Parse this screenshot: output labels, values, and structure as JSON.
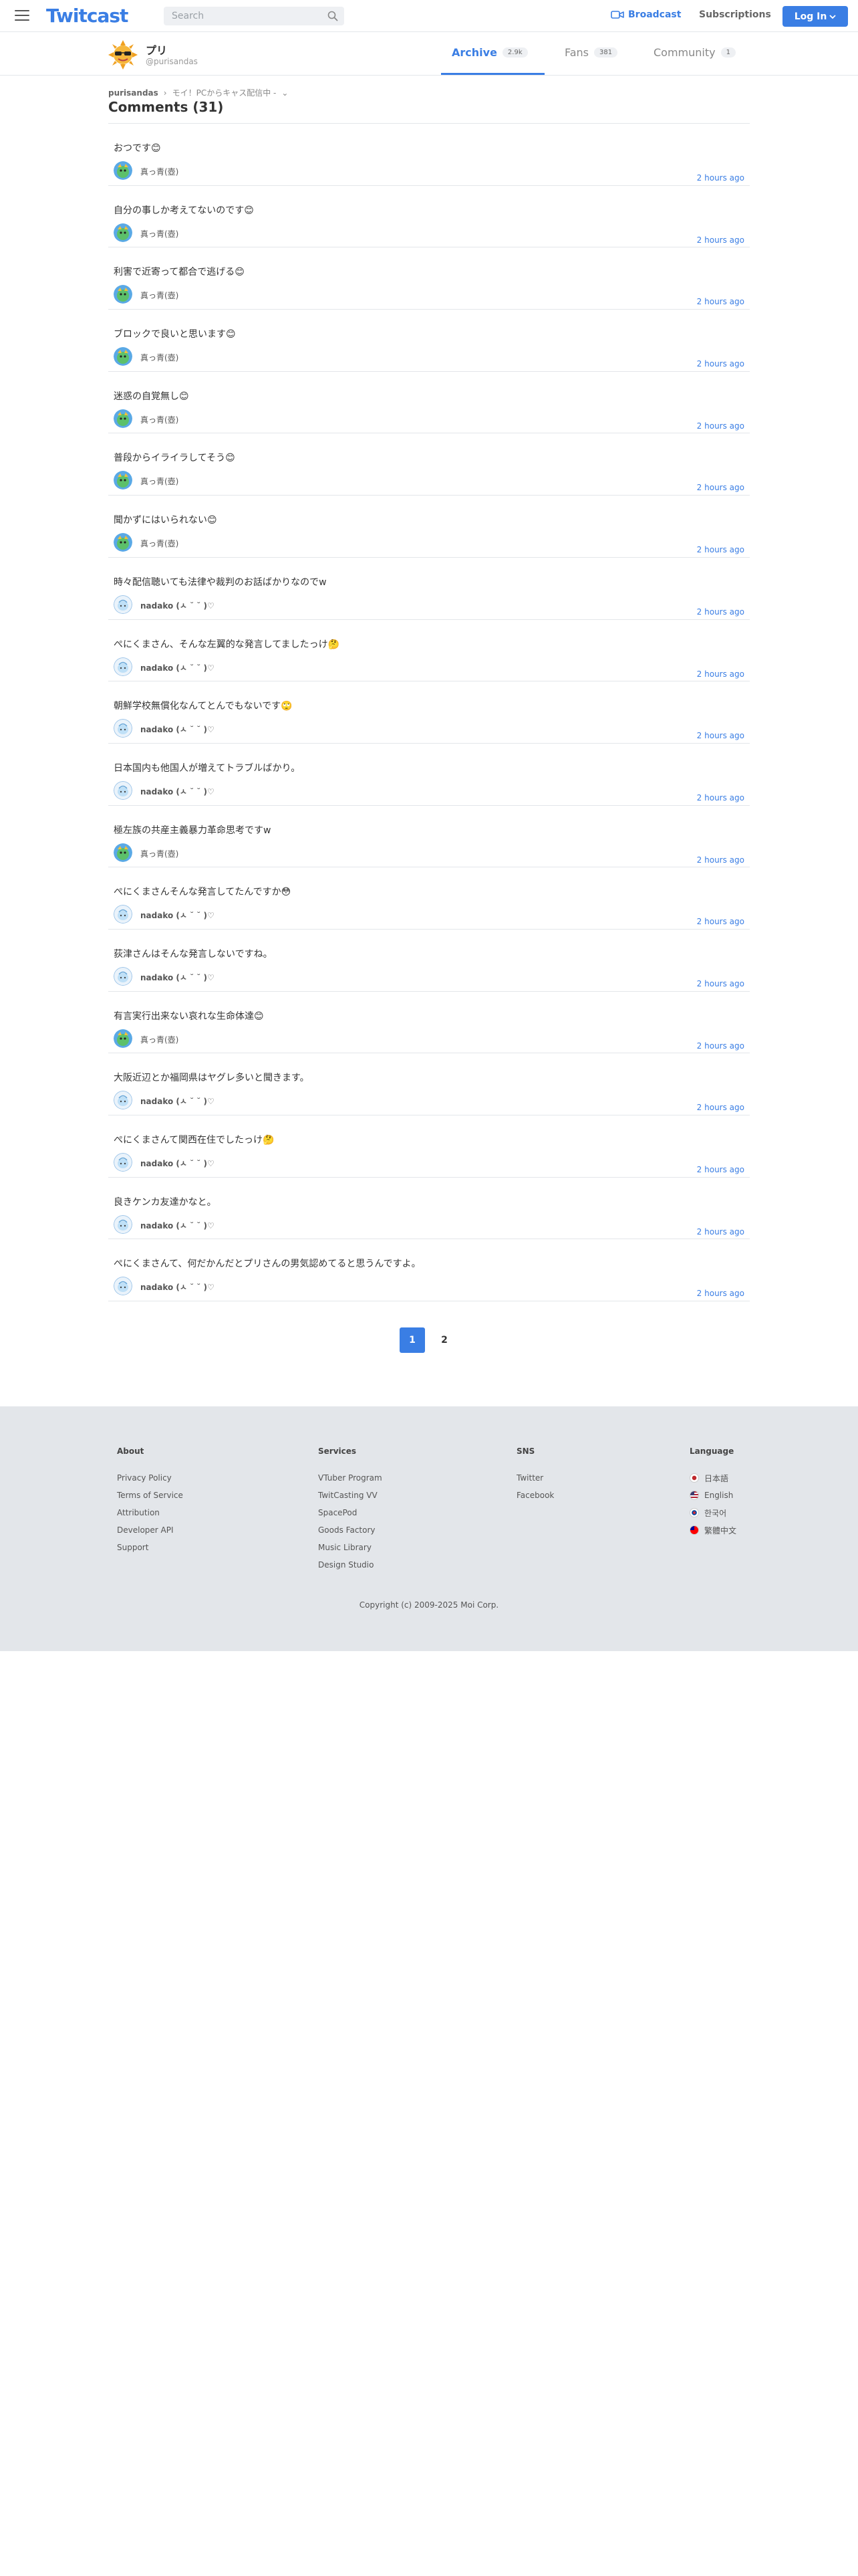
{
  "header": {
    "logo": "Twitcast",
    "search_placeholder": "Search",
    "broadcast_label": "Broadcast",
    "subscriptions_label": "Subscriptions",
    "login_label": "Log In"
  },
  "profile": {
    "name": "プリ",
    "handle": "@purisandas",
    "tabs": [
      {
        "label": "Archive",
        "count": "2.9k",
        "active": true
      },
      {
        "label": "Fans",
        "count": "381",
        "active": false
      },
      {
        "label": "Community",
        "count": "1",
        "active": false
      }
    ]
  },
  "breadcrumb": {
    "user": "purisandas",
    "separator": "›",
    "movie": "モイ！PCからキャス配信中 -",
    "chevron": "⌄"
  },
  "page_title": "Comments (31)",
  "comments": [
    {
      "text": "おつです😊",
      "user": "真っ青(壺)",
      "avatar": "green",
      "time": "2 hours ago"
    },
    {
      "text": "自分の事しか考えてないのです😊",
      "user": "真っ青(壺)",
      "avatar": "green",
      "time": "2 hours ago"
    },
    {
      "text": "利害で近寄って都合で逃げる😊",
      "user": "真っ青(壺)",
      "avatar": "green",
      "time": "2 hours ago"
    },
    {
      "text": "ブロックで良いと思います😊",
      "user": "真っ青(壺)",
      "avatar": "green",
      "time": "2 hours ago"
    },
    {
      "text": "迷惑の自覚無し😊",
      "user": "真っ青(壺)",
      "avatar": "green",
      "time": "2 hours ago"
    },
    {
      "text": "普段からイライラしてそう😊",
      "user": "真っ青(壺)",
      "avatar": "green",
      "time": "2 hours ago"
    },
    {
      "text": "聞かずにはいられない😊",
      "user": "真っ青(壺)",
      "avatar": "green",
      "time": "2 hours ago"
    },
    {
      "text": "時々配信聴いても法律や裁判のお話ばかりなのでw",
      "user": "nadako (ㅅ ˘ ˘ )♡",
      "avatar": "blue",
      "time": "2 hours ago"
    },
    {
      "text": "ぺにくまさん、そんな左翼的な発言してましたっけ🤔",
      "user": "nadako (ㅅ ˘ ˘ )♡",
      "avatar": "blue",
      "time": "2 hours ago"
    },
    {
      "text": "朝鮮学校無償化なんてとんでもないです🙄",
      "user": "nadako (ㅅ ˘ ˘ )♡",
      "avatar": "blue",
      "time": "2 hours ago"
    },
    {
      "text": "日本国内も他国人が増えてトラブルばかり。",
      "user": "nadako (ㅅ ˘ ˘ )♡",
      "avatar": "blue",
      "time": "2 hours ago"
    },
    {
      "text": "極左族の共産主義暴力革命思考ですw",
      "user": "真っ青(壺)",
      "avatar": "green",
      "time": "2 hours ago"
    },
    {
      "text": "ぺにくまさんそんな発言してたんですか😳",
      "user": "nadako (ㅅ ˘ ˘ )♡",
      "avatar": "blue",
      "time": "2 hours ago"
    },
    {
      "text": "荻津さんはそんな発言しないですね。",
      "user": "nadako (ㅅ ˘ ˘ )♡",
      "avatar": "blue",
      "time": "2 hours ago"
    },
    {
      "text": "有言実行出来ない哀れな生命体達😊",
      "user": "真っ青(壺)",
      "avatar": "green",
      "time": "2 hours ago"
    },
    {
      "text": "大阪近辺とか福岡県はヤグレ多いと聞きます。",
      "user": "nadako (ㅅ ˘ ˘ )♡",
      "avatar": "blue",
      "time": "2 hours ago"
    },
    {
      "text": "ぺにくまさんて関西在住でしたっけ🤔",
      "user": "nadako (ㅅ ˘ ˘ )♡",
      "avatar": "blue",
      "time": "2 hours ago"
    },
    {
      "text": "良きケンカ友達かなと。",
      "user": "nadako (ㅅ ˘ ˘ )♡",
      "avatar": "blue",
      "time": "2 hours ago"
    },
    {
      "text": "ぺにくまさんて、何だかんだとプリさんの男気認めてると思うんですよ。",
      "user": "nadako (ㅅ ˘ ˘ )♡",
      "avatar": "blue",
      "time": "2 hours ago"
    }
  ],
  "pagination": [
    "1",
    "2"
  ],
  "footer": {
    "about": {
      "heading": "About",
      "links": [
        "Privacy Policy",
        "Terms of Service",
        "Attribution",
        "Developer API",
        "Support"
      ]
    },
    "services": {
      "heading": "Services",
      "links": [
        "VTuber Program",
        "TwitCasting VV",
        "SpacePod",
        "Goods Factory",
        "Music Library",
        "Design Studio"
      ]
    },
    "sns": {
      "heading": "SNS",
      "links": [
        "Twitter",
        "Facebook"
      ]
    },
    "language": {
      "heading": "Language",
      "links": [
        "日本語",
        "English",
        "한국어",
        "繁體中文"
      ]
    },
    "copyright": "Copyright (c) 2009-2025 Moi Corp."
  },
  "colors": {
    "accent": "#3a7ee4",
    "border": "#e3e6ea",
    "footer_bg": "#e3e6ea"
  }
}
